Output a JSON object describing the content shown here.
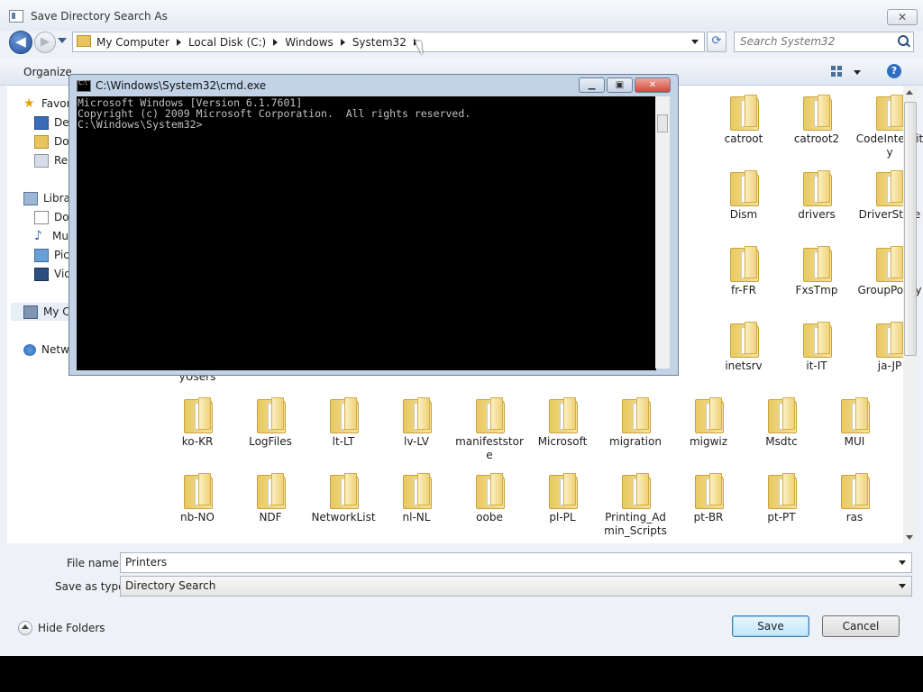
{
  "window": {
    "title": "Save Directory Search As",
    "close": "✕"
  },
  "nav": {
    "back": "◀",
    "forward": "▶",
    "refresh": "⟳",
    "breadcrumb": [
      "My Computer",
      "Local Disk (C:)",
      "Windows",
      "System32"
    ],
    "search_placeholder": "Search System32"
  },
  "toolbar": {
    "organize": "Organize",
    "help": "?"
  },
  "sidebar": [
    {
      "label": "Favorites",
      "icon": "star-icon"
    },
    {
      "label": "Desktop",
      "icon": "desktop-icon"
    },
    {
      "label": "Downloads",
      "icon": "downloads-icon"
    },
    {
      "label": "Recent Places",
      "icon": "recent-places-icon"
    },
    {
      "label": "Libraries",
      "icon": "libraries-icon"
    },
    {
      "label": "Documents",
      "icon": "documents-icon"
    },
    {
      "label": "Music",
      "icon": "music-icon"
    },
    {
      "label": "Pictures",
      "icon": "pictures-icon"
    },
    {
      "label": "Videos",
      "icon": "videos-icon"
    },
    {
      "label": "My Computer",
      "icon": "computer-icon"
    },
    {
      "label": "Network",
      "icon": "network-icon"
    }
  ],
  "folders": [
    "catroot",
    "catroot2",
    "CodeIntegrity",
    "Dism",
    "drivers",
    "DriverStore",
    "fr-FR",
    "FxsTmp",
    "GroupPolicy",
    "inetsrv",
    "it-IT",
    "ja-JP",
    "ko-KR",
    "LogFiles",
    "lt-LT",
    "lv-LV",
    "manifeststore",
    "Microsoft",
    "migration",
    "migwiz",
    "Msdtc",
    "MUI",
    "nb-NO",
    "NDF",
    "NetworkList",
    "nl-NL",
    "oobe",
    "pl-PL",
    "Printing_Admin_Scripts",
    "pt-BR",
    "pt-PT",
    "ras"
  ],
  "partial_label": "yUsers",
  "form": {
    "filename_label": "File name:",
    "filename_value": "Printers",
    "type_label": "Save as type:",
    "type_value": "Directory Search"
  },
  "actions": {
    "hide_folders": "Hide Folders",
    "save": "Save",
    "cancel": "Cancel"
  },
  "cmd": {
    "title": "C:\\Windows\\System32\\cmd.exe",
    "buttons": {
      "min": "▁",
      "max": "▣",
      "close": "✕"
    },
    "lines": [
      "Microsoft Windows [Version 6.1.7601]",
      "Copyright (c) 2009 Microsoft Corporation.  All rights reserved.",
      "",
      "C:\\Windows\\System32>"
    ]
  }
}
